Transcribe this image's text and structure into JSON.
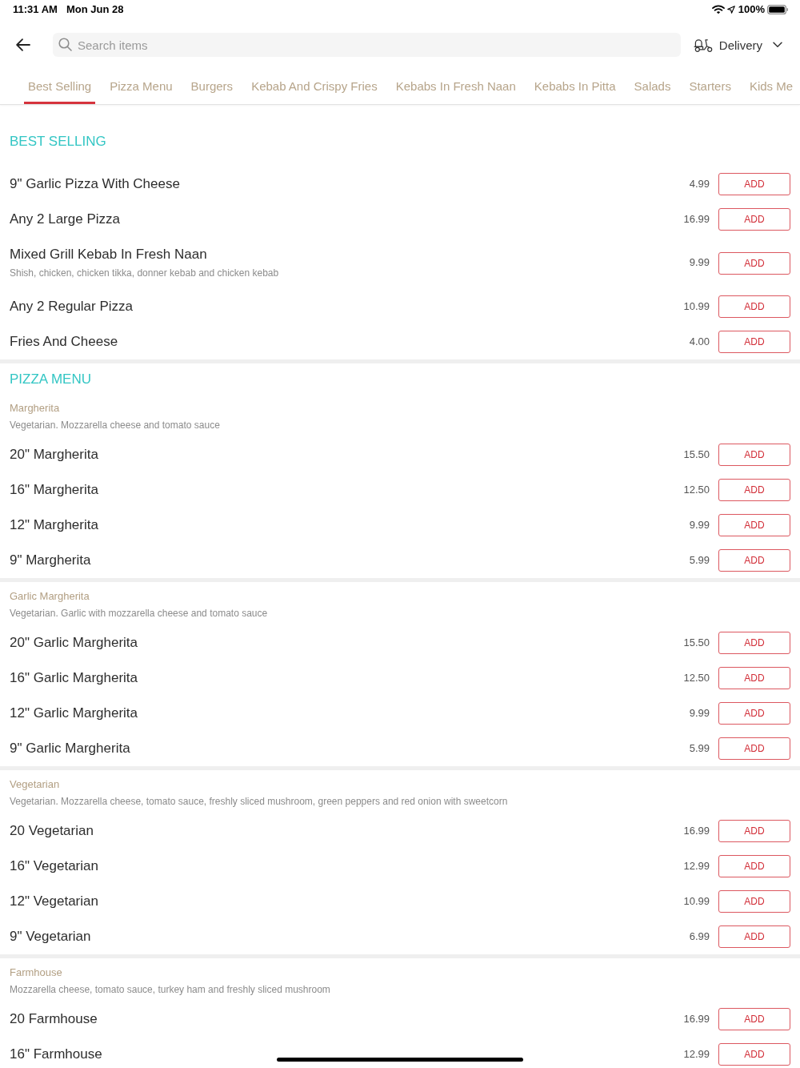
{
  "status_bar": {
    "time": "11:31 AM",
    "date": "Mon Jun 28",
    "battery": "100%"
  },
  "header": {
    "search": {
      "placeholder": "Search items"
    },
    "delivery": {
      "label": "Delivery"
    }
  },
  "tabs": [
    {
      "label": "Best Selling",
      "selected": true
    },
    {
      "label": "Pizza Menu",
      "selected": false
    },
    {
      "label": "Burgers",
      "selected": false
    },
    {
      "label": "Kebab And Crispy Fries",
      "selected": false
    },
    {
      "label": "Kebabs In Fresh Naan",
      "selected": false
    },
    {
      "label": "Kebabs In Pitta",
      "selected": false
    },
    {
      "label": "Salads",
      "selected": false
    },
    {
      "label": "Starters",
      "selected": false
    },
    {
      "label": "Kids Me",
      "selected": false
    }
  ],
  "sections": [
    {
      "title": "BEST SELLING",
      "groups": [
        {
          "items": [
            {
              "name": "9\" Garlic Pizza With Cheese",
              "price": "4.99",
              "button": "ADD"
            },
            {
              "name": "Any 2 Large Pizza",
              "price": "16.99",
              "button": "ADD"
            },
            {
              "name": "Mixed Grill Kebab In Fresh Naan",
              "description": "Shish, chicken, chicken tikka, donner kebab and chicken kebab",
              "price": "9.99",
              "button": "ADD"
            },
            {
              "name": "Any 2 Regular Pizza",
              "price": "10.99",
              "button": "ADD"
            },
            {
              "name": "Fries And Cheese",
              "price": "4.00",
              "button": "ADD"
            }
          ]
        }
      ]
    },
    {
      "title": "PIZZA MENU",
      "groups": [
        {
          "name": "Margherita",
          "description": "Vegetarian. Mozzarella cheese and tomato sauce",
          "items": [
            {
              "name": "20\" Margherita",
              "price": "15.50",
              "button": "ADD"
            },
            {
              "name": "16\" Margherita",
              "price": "12.50",
              "button": "ADD"
            },
            {
              "name": "12\" Margherita",
              "price": "9.99",
              "button": "ADD"
            },
            {
              "name": "9\" Margherita",
              "price": "5.99",
              "button": "ADD"
            }
          ]
        },
        {
          "name": "Garlic Margherita",
          "description": "Vegetarian. Garlic with mozzarella cheese and tomato sauce",
          "items": [
            {
              "name": "20\" Garlic Margherita",
              "price": "15.50",
              "button": "ADD"
            },
            {
              "name": "16\" Garlic Margherita",
              "price": "12.50",
              "button": "ADD"
            },
            {
              "name": "12\" Garlic Margherita",
              "price": "9.99",
              "button": "ADD"
            },
            {
              "name": "9\" Garlic Margherita",
              "price": "5.99",
              "button": "ADD"
            }
          ]
        },
        {
          "name": "Vegetarian",
          "description": "Vegetarian. Mozzarella cheese, tomato sauce, freshly sliced mushroom, green peppers and red onion with sweetcorn",
          "items": [
            {
              "name": "20 Vegetarian",
              "price": "16.99",
              "button": "ADD"
            },
            {
              "name": "16\" Vegetarian",
              "price": "12.99",
              "button": "ADD"
            },
            {
              "name": "12\" Vegetarian",
              "price": "10.99",
              "button": "ADD"
            },
            {
              "name": "9\" Vegetarian",
              "price": "6.99",
              "button": "ADD"
            }
          ]
        },
        {
          "name": "Farmhouse",
          "description": "Mozzarella cheese, tomato sauce, turkey ham and freshly sliced mushroom",
          "items": [
            {
              "name": "20 Farmhouse",
              "price": "16.99",
              "button": "ADD"
            },
            {
              "name": "16\" Farmhouse",
              "price": "12.99",
              "button": "ADD"
            }
          ]
        }
      ]
    }
  ]
}
